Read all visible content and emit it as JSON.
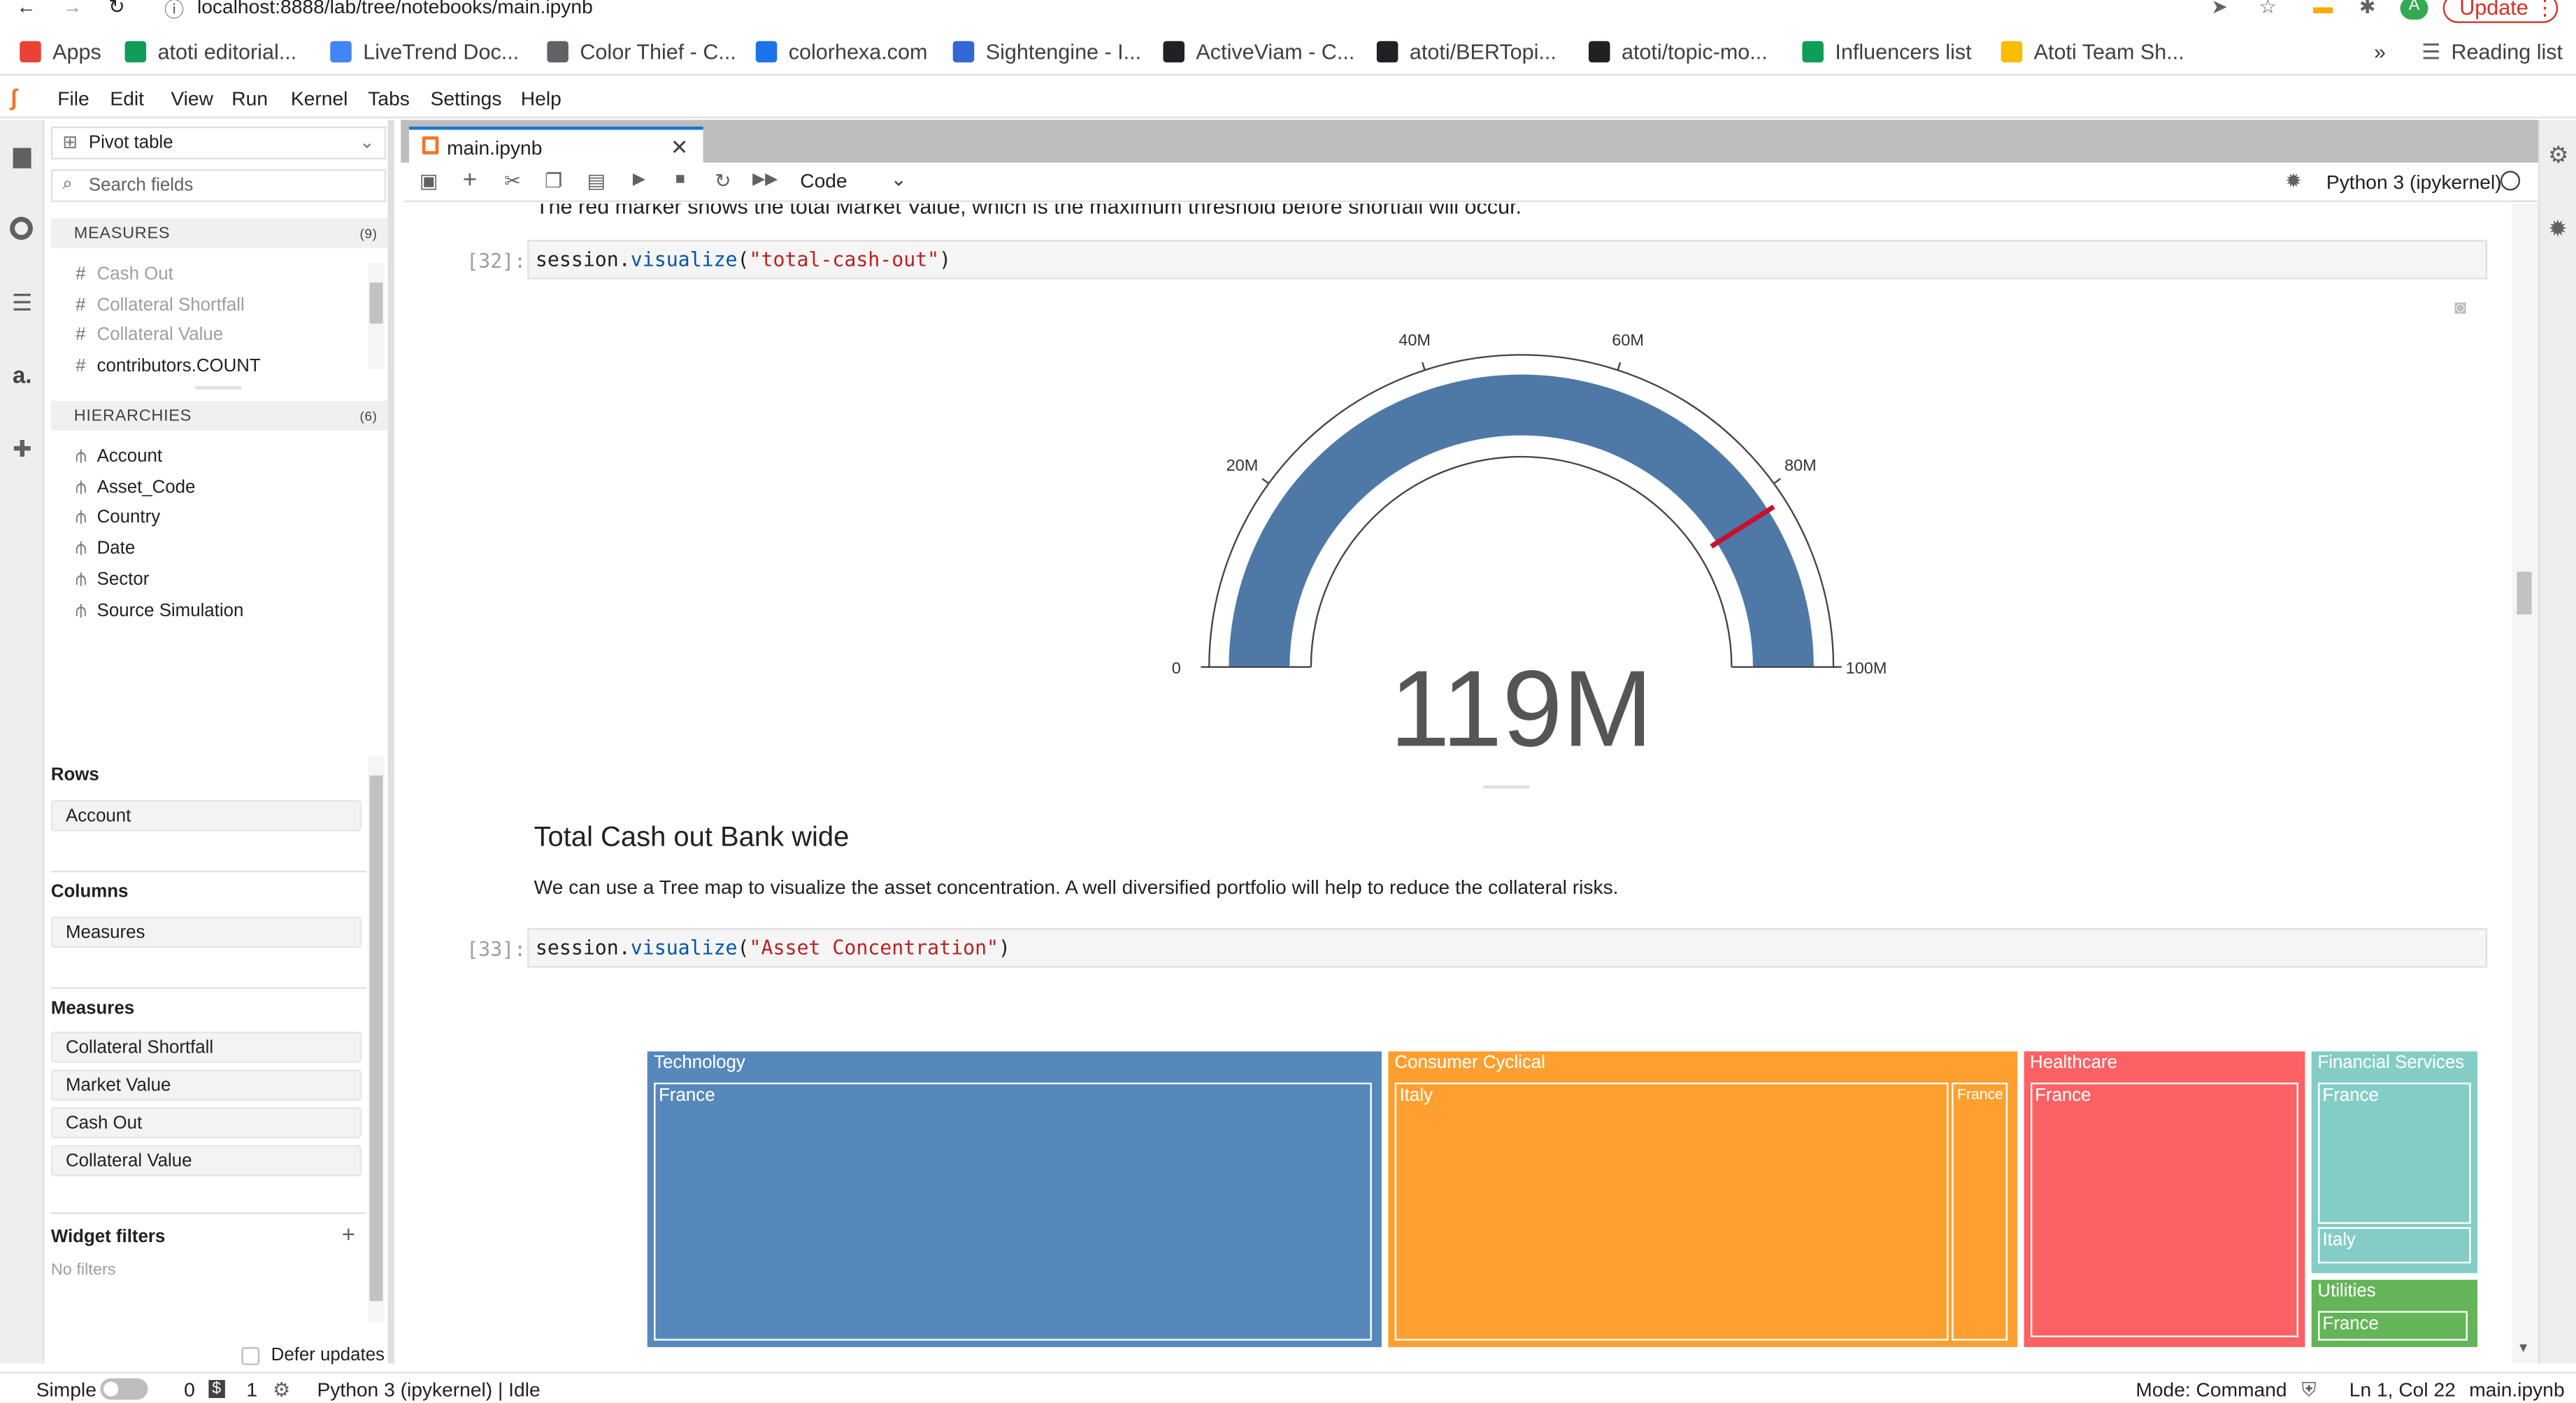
{
  "browser": {
    "url": "localhost:8888/lab/tree/notebooks/main.ipynb",
    "update_label": "Update",
    "bookmarks": [
      {
        "label": "Apps",
        "color": "#ea4335"
      },
      {
        "label": "atoti editorial...",
        "color": "#0f9d58"
      },
      {
        "label": "LiveTrend Doc...",
        "color": "#4285f4"
      },
      {
        "label": "Color Thief - C...",
        "color": "#5f6368"
      },
      {
        "label": "colorhexa.com",
        "color": "#1a73e8"
      },
      {
        "label": "Sightengine - I...",
        "color": "#3367d6"
      },
      {
        "label": "ActiveViam - C...",
        "color": "#202124"
      },
      {
        "label": "atoti/BERTopi...",
        "color": "#202124"
      },
      {
        "label": "atoti/topic-mo...",
        "color": "#202124"
      },
      {
        "label": "Influencers list",
        "color": "#0f9d58"
      },
      {
        "label": "Atoti Team Sh...",
        "color": "#fbbc04"
      }
    ],
    "more": "»",
    "reading_list": "Reading list"
  },
  "menu": [
    "File",
    "Edit",
    "View",
    "Run",
    "Kernel",
    "Tabs",
    "Settings",
    "Help"
  ],
  "left_panel": {
    "widget_type": "Pivot table",
    "search_placeholder": "Search fields",
    "measures_label": "MEASURES",
    "measures_count": "(9)",
    "measures": [
      "Cash Out",
      "Collateral Shortfall",
      "Collateral Value",
      "contributors.COUNT"
    ],
    "hierarchies_label": "HIERARCHIES",
    "hierarchies_count": "(6)",
    "hierarchies": [
      "Account",
      "Asset_Code",
      "Country",
      "Date",
      "Sector",
      "Source Simulation"
    ],
    "rows_label": "Rows",
    "rows": [
      "Account"
    ],
    "columns_label": "Columns",
    "columns": [
      "Measures"
    ],
    "measures_zone_label": "Measures",
    "measures_zone": [
      "Collateral Shortfall",
      "Market Value",
      "Cash Out",
      "Collateral Value"
    ],
    "filters_label": "Widget filters",
    "filters_add": "+",
    "no_filters": "No filters",
    "defer_updates": "Defer updates"
  },
  "notebook": {
    "tab_label": "main.ipynb",
    "cell_type": "Code",
    "kernel_label": "Python 3 (ipykernel)",
    "partial_text": "The red marker shows the total Market Value, which is the maximum threshold before shortfall will occur.",
    "cell1_prompt": "[32]:",
    "cell1_obj": "session",
    "cell1_method": "visualize",
    "cell1_arg": "\"total-cash-out\"",
    "heading": "Total Cash out Bank wide",
    "paragraph": "We can use a Tree map to visualize the asset concentration. A well diversified portfolio will help to reduce the collateral risks.",
    "cell2_prompt": "[33]:",
    "cell2_obj": "session",
    "cell2_method": "visualize",
    "cell2_arg": "\"Asset Concentration\""
  },
  "chart_data": [
    {
      "type": "gauge",
      "value_label": "119M",
      "min": 0,
      "max": 100,
      "unit": "M",
      "ticks": [
        {
          "value": 0,
          "label": "0"
        },
        {
          "value": 20,
          "label": "20M"
        },
        {
          "value": 40,
          "label": "40M"
        },
        {
          "value": 60,
          "label": "60M"
        },
        {
          "value": 80,
          "label": "80M"
        },
        {
          "value": 100,
          "label": "100M"
        }
      ],
      "fill_value": 100,
      "marker_value": 82,
      "fill_color": "#4e79a7",
      "marker_color": "#c8102e"
    },
    {
      "type": "treemap",
      "groups": [
        {
          "name": "Technology",
          "value": 39.7,
          "color": "#4e79a7",
          "children": [
            {
              "name": "France",
              "value": 39.7
            }
          ]
        },
        {
          "name": "Consumer Cyclical",
          "value": 34.0,
          "color": "#f28e2b",
          "children": [
            {
              "name": "Italy",
              "value": 30.8
            },
            {
              "name": "France",
              "value": 3.2
            }
          ]
        },
        {
          "name": "Healthcare",
          "value": 15.2,
          "color": "#e15759",
          "children": [
            {
              "name": "France",
              "value": 15.2
            }
          ]
        },
        {
          "name": "Financial Services",
          "value": 6.9,
          "color": "#76b7b2",
          "children": [
            {
              "name": "France",
              "value": 5.4
            },
            {
              "name": "Italy",
              "value": 1.5
            }
          ]
        },
        {
          "name": "Utilities",
          "value": 2.1,
          "color": "#59a14f",
          "children": [
            {
              "name": "France",
              "value": 2.1
            }
          ]
        }
      ]
    }
  ],
  "status": {
    "mode_simple": "Simple",
    "count0": "0",
    "count1": "1",
    "kernel_status": "Python 3 (ipykernel) | Idle",
    "mode": "Mode: Command",
    "position": "Ln 1, Col 22",
    "file": "main.ipynb"
  }
}
